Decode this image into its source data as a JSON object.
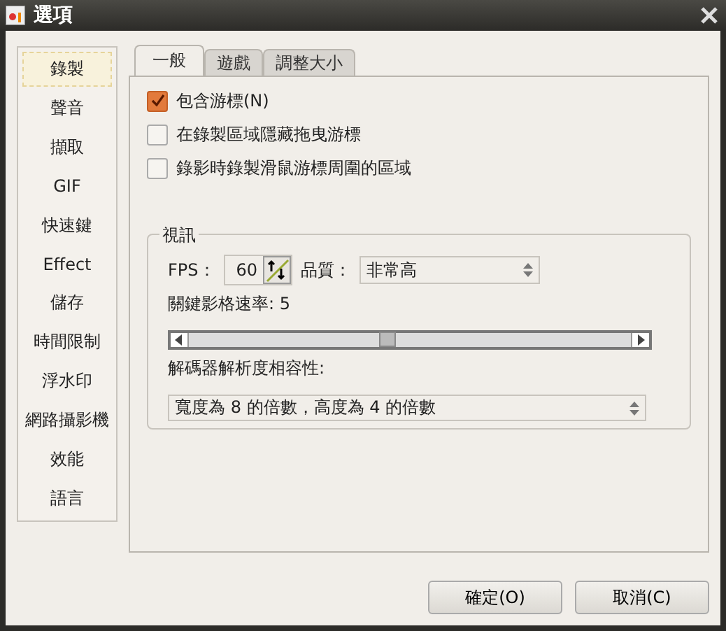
{
  "window": {
    "title": "選項"
  },
  "sidebar": {
    "items": [
      {
        "label": "錄製",
        "selected": true
      },
      {
        "label": "聲音",
        "selected": false
      },
      {
        "label": "擷取",
        "selected": false
      },
      {
        "label": "GIF",
        "selected": false
      },
      {
        "label": "快速鍵",
        "selected": false
      },
      {
        "label": "Effect",
        "selected": false
      },
      {
        "label": "儲存",
        "selected": false
      },
      {
        "label": "時間限制",
        "selected": false
      },
      {
        "label": "浮水印",
        "selected": false
      },
      {
        "label": "網路攝影機",
        "selected": false
      },
      {
        "label": "效能",
        "selected": false
      },
      {
        "label": "語言",
        "selected": false
      }
    ]
  },
  "tabs": [
    {
      "label": "一般",
      "selected": true
    },
    {
      "label": "遊戲",
      "selected": false
    },
    {
      "label": "調整大小",
      "selected": false
    }
  ],
  "options": [
    {
      "label": "包含游標(N)",
      "checked": true
    },
    {
      "label": "在錄製區域隱藏拖曳游標",
      "checked": false
    },
    {
      "label": "錄影時錄製滑鼠游標周圍的區域",
      "checked": false
    }
  ],
  "video": {
    "title": "視訊",
    "fps_label": "FPS：",
    "fps_value": "60",
    "quality_label": "品質：",
    "quality_value": "非常高",
    "keyframe_label": "關鍵影格速率: 5",
    "keyframe_slider": {
      "level": 0.45
    },
    "compat_label": "解碼器解析度相容性:",
    "compat_value": "寬度為 8 的倍數，高度為 4 的倍數"
  },
  "buttons": [
    "確定(O)",
    "取消(C)"
  ]
}
